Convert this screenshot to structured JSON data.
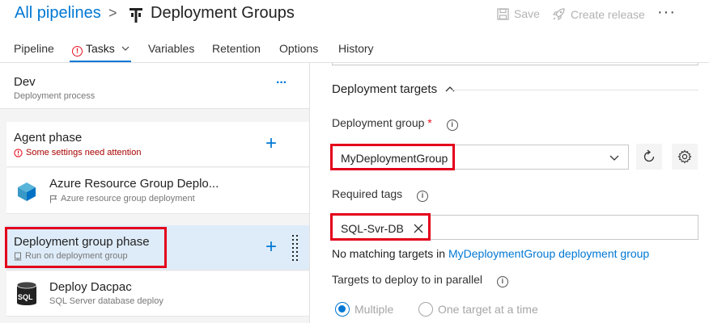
{
  "header": {
    "breadcrumb_root": "All pipelines",
    "separator": ">",
    "title": "Deployment Groups",
    "save_label": "Save",
    "create_release_label": "Create release",
    "more_label": "···"
  },
  "tabs": {
    "pipeline": "Pipeline",
    "tasks": "Tasks",
    "variables": "Variables",
    "retention": "Retention",
    "options": "Options",
    "history": "History"
  },
  "stage": {
    "name": "Dev",
    "subtitle": "Deployment process",
    "more": "···"
  },
  "agent_phase": {
    "title": "Agent phase",
    "warning": "Some settings need attention"
  },
  "task_azure": {
    "title": "Azure Resource Group Deplo...",
    "subtitle": "Azure resource group deployment"
  },
  "deployment_phase": {
    "title": "Deployment group phase",
    "subtitle": "Run on deployment group"
  },
  "task_dacpac": {
    "title": "Deploy Dacpac",
    "subtitle": "SQL Server database deploy",
    "icon_text": "SQL"
  },
  "right": {
    "section_title": "Deployment targets",
    "group_label": "Deployment group",
    "required_mark": "*",
    "group_value": "MyDeploymentGroup",
    "tags_label": "Required tags",
    "tag_value": "SQL-Svr-DB",
    "no_match_prefix": "No matching targets in ",
    "no_match_link": "MyDeploymentGroup deployment group",
    "parallel_label": "Targets to deploy to in parallel",
    "radio_multiple": "Multiple",
    "radio_one": "One target at a time",
    "selected_radio": "Multiple"
  },
  "colors": {
    "accent": "#0078d4",
    "highlight_border": "#e3001b",
    "selected_row": "#deecf9",
    "warning": "#e81123"
  },
  "icons": {
    "tasks_tab": "warning-circle-icon",
    "tab_chevron": "chevron-down-icon",
    "save": "save-icon",
    "create_release": "rocket-icon",
    "refresh": "refresh-icon",
    "manage": "gear-icon",
    "tag_remove": "close-icon",
    "info": "info-icon"
  }
}
